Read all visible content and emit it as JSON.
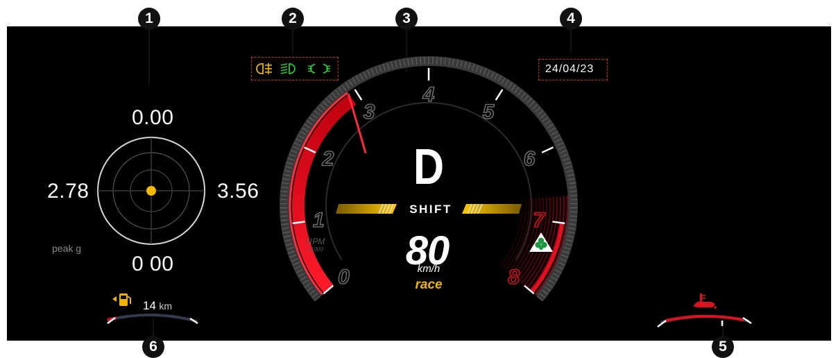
{
  "callouts": [
    "1",
    "2",
    "3",
    "4",
    "5",
    "6"
  ],
  "gmeter": {
    "top": "0.00",
    "left": "2.78",
    "right": "3.56",
    "bottom": "0 00",
    "peak_label": "peak g"
  },
  "warning_lights": [
    "fog-light-icon",
    "low-beam-icon",
    "position-lights-icon"
  ],
  "date": "24/04/23",
  "tachometer": {
    "ticks": [
      "0",
      "1",
      "2",
      "3",
      "4",
      "5",
      "6",
      "7",
      "8"
    ],
    "rpm_label": "RPM",
    "rpm_multiplier": "x1000",
    "redline_start": 7
  },
  "gear": "D",
  "shift_label": "SHIFT",
  "speed": "80",
  "speed_unit": "km/h",
  "drive_mode": "race",
  "fuel": {
    "range_value": "14",
    "range_unit": "km",
    "level": 0.1
  },
  "oil_temp": {
    "level": 0.5
  },
  "colors": {
    "accent_red": "#e01020",
    "shift_yellow": "#f5b800",
    "mode_yellow": "#f0b400",
    "light_green": "#22cc33",
    "light_amber": "#f2b400"
  }
}
